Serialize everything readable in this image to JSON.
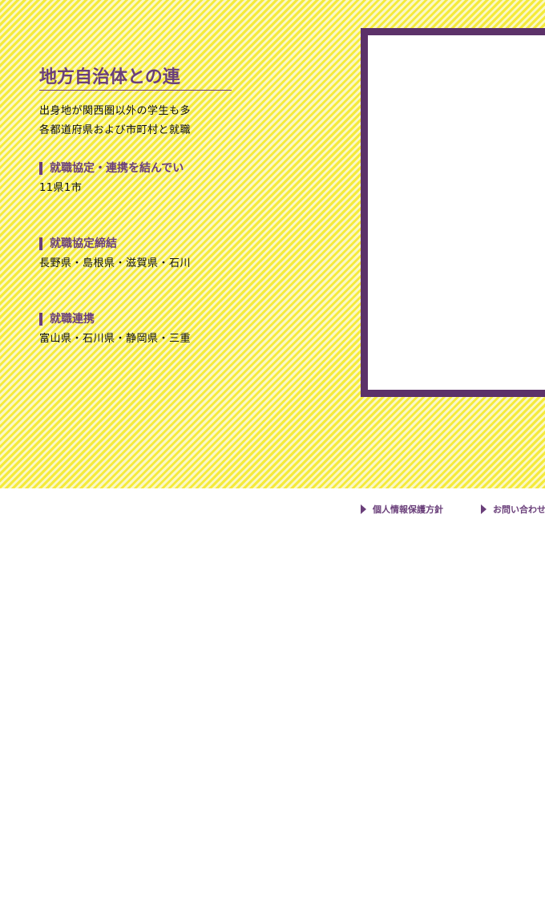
{
  "section": {
    "title": "地方自治体との連",
    "intro_lines": [
      "出身地が関西圏以外の学生も多",
      "各都道府県および市町村と就職"
    ],
    "blocks": [
      {
        "heading": "就職協定・連携を結んでい",
        "body": "11県1市"
      },
      {
        "heading": "就職協定締結",
        "body": "長野県・島根県・滋賀県・石川"
      },
      {
        "heading": "就職連携",
        "body": "富山県・石川県・静岡県・三重"
      }
    ]
  },
  "footer": {
    "links": [
      {
        "label": "個人情報保護方針",
        "icon": "triangle-right-icon"
      },
      {
        "label": "お問い合わせ",
        "icon": "triangle-right-icon"
      }
    ]
  },
  "colors": {
    "accent": "#6a3f7a",
    "frame": "#5c3169",
    "stripe_yellow": "#f4ea3c",
    "stripe_light": "#fbf8c4"
  }
}
